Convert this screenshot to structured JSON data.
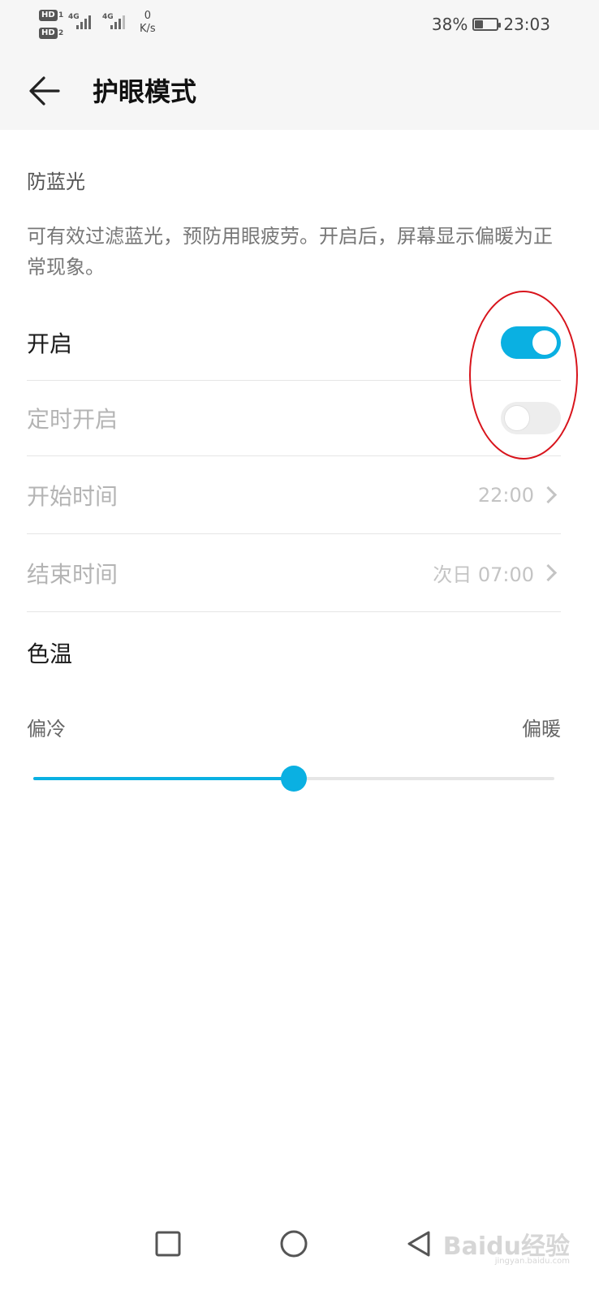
{
  "status_bar": {
    "sim1_badge": "HD",
    "sim1_num": "1",
    "sim2_badge": "HD",
    "sim2_num": "2",
    "net1": "4G",
    "net2": "4G",
    "speed_value": "0",
    "speed_unit": "K/s",
    "battery_text": "38%",
    "battery_level": 0.38,
    "time": "23:03"
  },
  "header": {
    "back_icon": "arrow-left-icon",
    "title": "护眼模式"
  },
  "section": {
    "title": "防蓝光",
    "description": "可有效过滤蓝光，预防用眼疲劳。开启后，屏幕显示偏暖为正常现象。"
  },
  "rows": {
    "enable": {
      "label": "开启",
      "state": true
    },
    "schedule": {
      "label": "定时开启",
      "state": false
    },
    "start_time": {
      "label": "开始时间",
      "value": "22:00"
    },
    "end_time": {
      "label": "结束时间",
      "value": "次日 07:00"
    }
  },
  "color_temp": {
    "title": "色温",
    "min_label": "偏冷",
    "max_label": "偏暖",
    "level": 0.5
  },
  "nav": {
    "recent_icon": "square-icon",
    "home_icon": "circle-icon",
    "back_icon": "triangle-back-icon"
  },
  "watermark": {
    "text": "Baidu经验",
    "url": "jingyan.baidu.com"
  },
  "colors": {
    "accent": "#0ab0e2",
    "annotation": "#d8141c"
  }
}
